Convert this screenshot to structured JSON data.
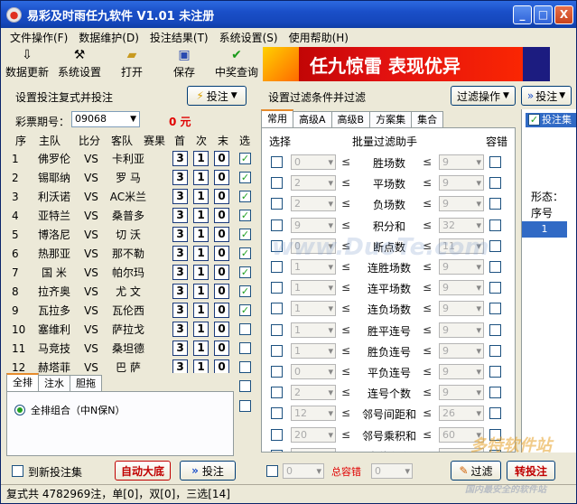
{
  "window": {
    "title": "易彩及时雨任九软件 V1.01 未注册",
    "minimize": "_",
    "maximize": "□",
    "close": "X"
  },
  "menu": [
    "文件操作(F)",
    "数据维护(D)",
    "投注结果(T)",
    "系统设置(S)",
    "使用帮助(H)"
  ],
  "toolbar": [
    "数据更新",
    "系统设置",
    "打开",
    "保存",
    "中奖查询"
  ],
  "banner": {
    "text": "任九惊雷 表现优异"
  },
  "left": {
    "section_title": "设置投注复式并投注",
    "bet_button": "投注",
    "period_label": "彩票期号：",
    "period_value": "09068",
    "amount": "0 元",
    "headers": [
      "序",
      "主队",
      "比分",
      "客队",
      "赛果",
      "首",
      "次",
      "末",
      "选"
    ],
    "matches": [
      {
        "no": "1",
        "home": "佛罗伦",
        "vs": "VS",
        "away": "卡利亚",
        "first": "3",
        "second": "1",
        "last": "0",
        "checked": true
      },
      {
        "no": "2",
        "home": "锡耶纳",
        "vs": "VS",
        "away": "罗 马",
        "first": "3",
        "second": "1",
        "last": "0",
        "checked": true
      },
      {
        "no": "3",
        "home": "利沃诺",
        "vs": "VS",
        "away": "AC米兰",
        "first": "3",
        "second": "1",
        "last": "0",
        "checked": true
      },
      {
        "no": "4",
        "home": "亚特兰",
        "vs": "VS",
        "away": "桑普多",
        "first": "3",
        "second": "1",
        "last": "0",
        "checked": true
      },
      {
        "no": "5",
        "home": "博洛尼",
        "vs": "VS",
        "away": "切 沃",
        "first": "3",
        "second": "1",
        "last": "0",
        "checked": true
      },
      {
        "no": "6",
        "home": "热那亚",
        "vs": "VS",
        "away": "那不勒",
        "first": "3",
        "second": "1",
        "last": "0",
        "checked": true
      },
      {
        "no": "7",
        "home": "国 米",
        "vs": "VS",
        "away": "帕尔玛",
        "first": "3",
        "second": "1",
        "last": "0",
        "checked": true
      },
      {
        "no": "8",
        "home": "拉齐奥",
        "vs": "VS",
        "away": "尤 文",
        "first": "3",
        "second": "1",
        "last": "0",
        "checked": true
      },
      {
        "no": "9",
        "home": "瓦拉多",
        "vs": "VS",
        "away": "瓦伦西",
        "first": "3",
        "second": "1",
        "last": "0",
        "checked": true
      },
      {
        "no": "10",
        "home": "塞维利",
        "vs": "VS",
        "away": "萨拉戈",
        "first": "3",
        "second": "1",
        "last": "0",
        "checked": false
      },
      {
        "no": "11",
        "home": "马竞技",
        "vs": "VS",
        "away": "桑坦德",
        "first": "3",
        "second": "1",
        "last": "0",
        "checked": false
      },
      {
        "no": "12",
        "home": "赫塔菲",
        "vs": "VS",
        "away": "巴 萨",
        "first": "3",
        "second": "1",
        "last": "0",
        "checked": false
      }
    ],
    "tabs": [
      "全排",
      "注水",
      "胆拖"
    ],
    "radio_label": "全排组合（中N保N）",
    "new_bet_label": "到新投注集",
    "auto_button": "自动大底",
    "submit_button": "投注"
  },
  "mid": {
    "section_title": "设置过滤条件并过滤",
    "filter_button": "过滤操作",
    "tabs": [
      "常用",
      "高级A",
      "高级B",
      "方案集",
      "集合"
    ],
    "headers": {
      "select": "选择",
      "helper": "批量过滤助手",
      "tolerance": "容错"
    },
    "filters": [
      {
        "low": "0",
        "name": "胜场数",
        "high": "9"
      },
      {
        "low": "2",
        "name": "平场数",
        "high": "9"
      },
      {
        "low": "2",
        "name": "负场数",
        "high": "9"
      },
      {
        "low": "9",
        "name": "积分和",
        "high": "32"
      },
      {
        "low": "0",
        "name": "断点数",
        "high": "11"
      },
      {
        "low": "1",
        "name": "连胜场数",
        "high": "9"
      },
      {
        "low": "1",
        "name": "连平场数",
        "high": "9"
      },
      {
        "low": "1",
        "name": "连负场数",
        "high": "9"
      },
      {
        "low": "1",
        "name": "胜平连号",
        "high": "9"
      },
      {
        "low": "1",
        "name": "胜负连号",
        "high": "9"
      },
      {
        "low": "0",
        "name": "平负连号",
        "high": "9"
      },
      {
        "low": "2",
        "name": "连号个数",
        "high": "9"
      },
      {
        "low": "12",
        "name": "邻号间距和",
        "high": "26"
      },
      {
        "low": "20",
        "name": "邻号乘积和",
        "high": "60"
      },
      {
        "low": "20",
        "name": "尖位积和",
        "high": "60"
      }
    ],
    "total_tolerance": "总容错",
    "tol_low": "0",
    "tol_high": "0",
    "filter_action": "过滤",
    "bet_action": "转投注"
  },
  "right": {
    "bet_button": "投注",
    "item": "投注集",
    "shape_label": "形态：",
    "seq_label": "序号",
    "seq_value": "1"
  },
  "status": "复式共 4782969注，单[0]，双[0]，三选[14]",
  "watermark": {
    "a": "www.DuoTe.com",
    "b": "多特软件站",
    "c": "国内最安全的软件站"
  },
  "colors": {
    "title": "#1a4fc8",
    "amount": "#e00000",
    "banner": "#e01010",
    "check": "#21a121"
  }
}
